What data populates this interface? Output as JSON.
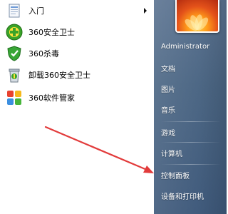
{
  "colors": {
    "right_pane_bg": "#4a6583",
    "arrow": "#e23b3b",
    "left_pane_bg": "#ffffff"
  },
  "programs": [
    {
      "label": "入门",
      "icon": "getting-started-icon",
      "has_submenu": true
    },
    {
      "label": "360安全卫士",
      "icon": "360-safe-guard-icon",
      "has_submenu": false
    },
    {
      "label": "360杀毒",
      "icon": "360-antivirus-icon",
      "has_submenu": false
    },
    {
      "label": "卸载360安全卫士",
      "icon": "uninstall-recycle-bin-icon",
      "has_submenu": false
    },
    {
      "label": "360软件管家",
      "icon": "360-software-manager-icon",
      "has_submenu": false
    }
  ],
  "right_pane": {
    "user_picture": "flower-user-picture",
    "items": [
      "Administrator",
      "文档",
      "图片",
      "音乐",
      "游戏",
      "计算机",
      "控制面板",
      "设备和打印机"
    ]
  },
  "annotation": {
    "arrow": "red-pointer-arrow",
    "target": "控制面板"
  }
}
